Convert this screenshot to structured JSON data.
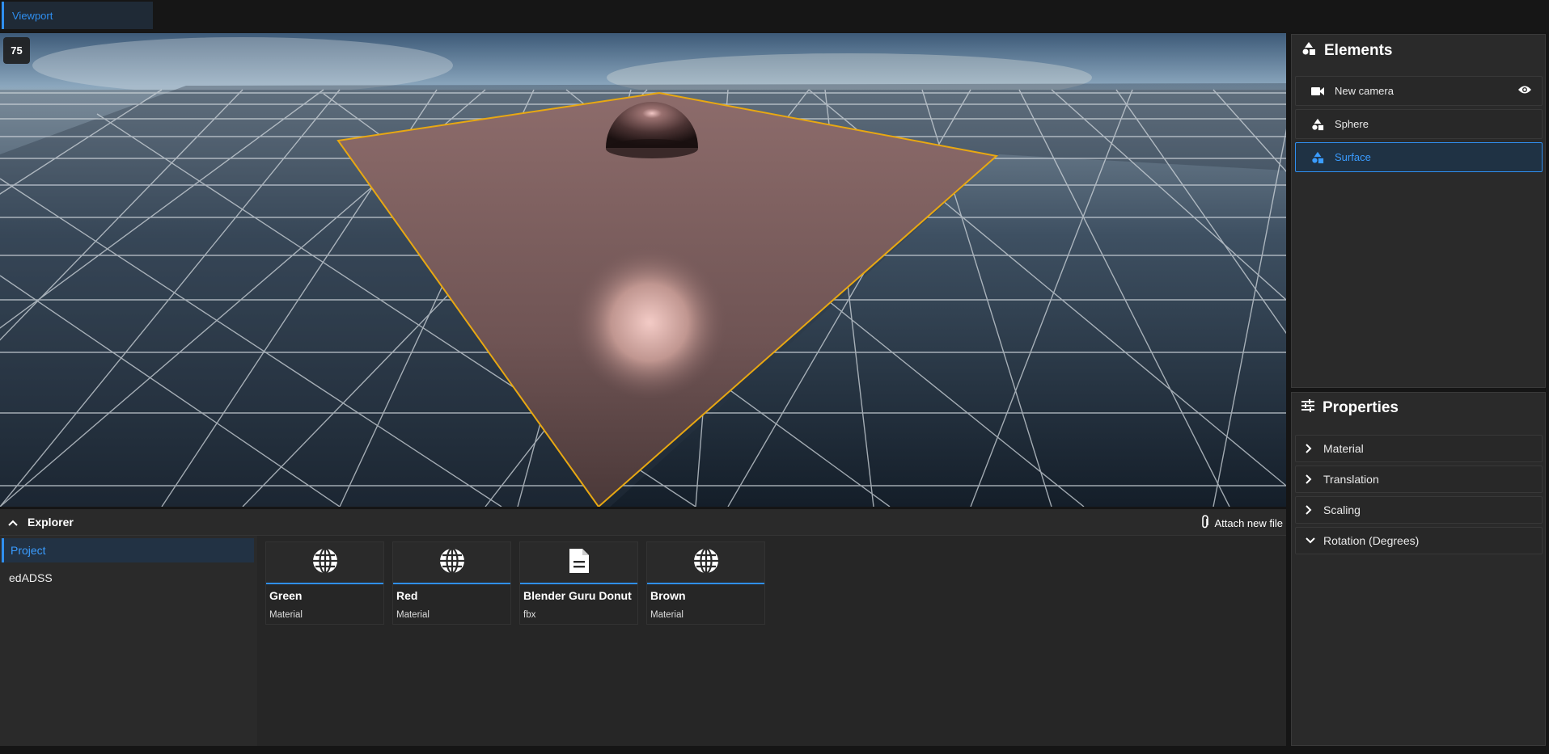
{
  "topbar": {
    "tab_label": "Viewport"
  },
  "viewport": {
    "fov_value": "75"
  },
  "elements": {
    "title": "Elements",
    "items": [
      {
        "label": "New camera",
        "icon": "camera-icon"
      },
      {
        "label": "Sphere",
        "icon": "shapes-icon"
      },
      {
        "label": "Surface",
        "icon": "shapes-icon",
        "selected": true
      }
    ]
  },
  "properties": {
    "title": "Properties",
    "items": [
      {
        "label": "Material",
        "expanded": false
      },
      {
        "label": "Translation",
        "expanded": false
      },
      {
        "label": "Scaling",
        "expanded": false
      },
      {
        "label": "Rotation (Degrees)",
        "expanded": true
      }
    ]
  },
  "explorer": {
    "title": "Explorer",
    "attach_label": "Attach new file",
    "sidebar": [
      {
        "label": "Project",
        "selected": true
      },
      {
        "label": "edADSS"
      }
    ],
    "cards": [
      {
        "name": "Green",
        "type": "Material",
        "icon": "globe-icon"
      },
      {
        "name": "Red",
        "type": "Material",
        "icon": "globe-icon"
      },
      {
        "name": "Blender Guru Donut",
        "type": "fbx",
        "icon": "file-icon"
      },
      {
        "name": "Brown",
        "type": "Material",
        "icon": "globe-icon"
      }
    ]
  },
  "colors": {
    "accent": "#2f8ff0",
    "selection_outline": "#f0a800",
    "surface": "#8a6666"
  }
}
